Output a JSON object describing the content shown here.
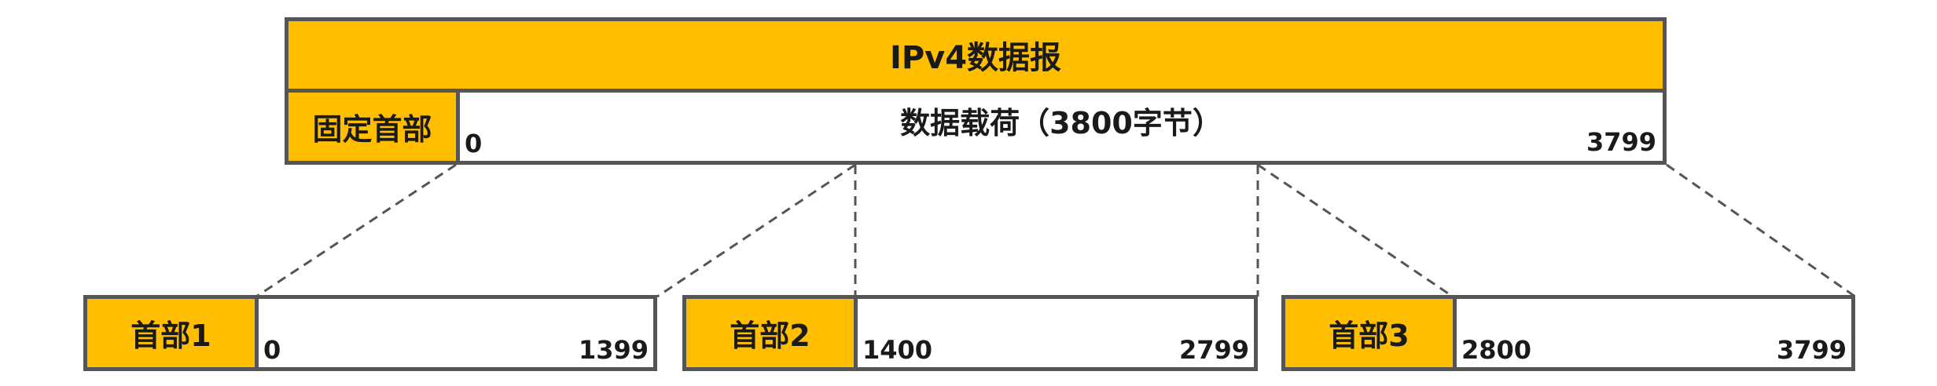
{
  "datagram": {
    "title": "IPv4数据报",
    "fixed_header": "固定首部",
    "payload_label": "数据载荷（3800字节）",
    "start": "0",
    "end": "3799"
  },
  "fragments": [
    {
      "header": "首部1",
      "start": "0",
      "end": "1399"
    },
    {
      "header": "首部2",
      "start": "1400",
      "end": "2799"
    },
    {
      "header": "首部3",
      "start": "2800",
      "end": "3799"
    }
  ],
  "colors": {
    "header_fill": "#FFBE00",
    "border": "#555555"
  }
}
